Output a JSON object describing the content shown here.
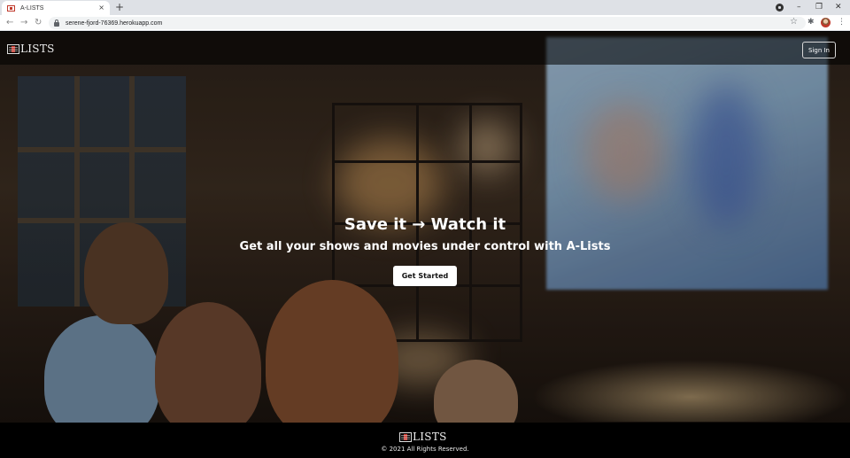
{
  "browser": {
    "tab_title": "A-LISTS",
    "tab_close": "×",
    "new_tab": "+",
    "url": "serene-fjord-76369.herokuapp.com",
    "back": "←",
    "forward": "→",
    "reload": "↻",
    "bookmark": "☆",
    "extensions": "✱",
    "menu": "⋮",
    "minimize": "–",
    "restore": "❐",
    "close": "✕"
  },
  "navbar": {
    "logo_text": "LISTS",
    "signin_label": "Sign In"
  },
  "hero": {
    "headline": "Save it → Watch it",
    "subline": "Get all your shows and movies under control with A-Lists",
    "cta_label": "Get Started"
  },
  "footer": {
    "logo_text": "LISTS",
    "copyright": "© 2021 All Rights Reserved."
  },
  "colors": {
    "accent": "#d2342a",
    "navbar_bg": "#000000",
    "button_bg": "#ffffff"
  }
}
